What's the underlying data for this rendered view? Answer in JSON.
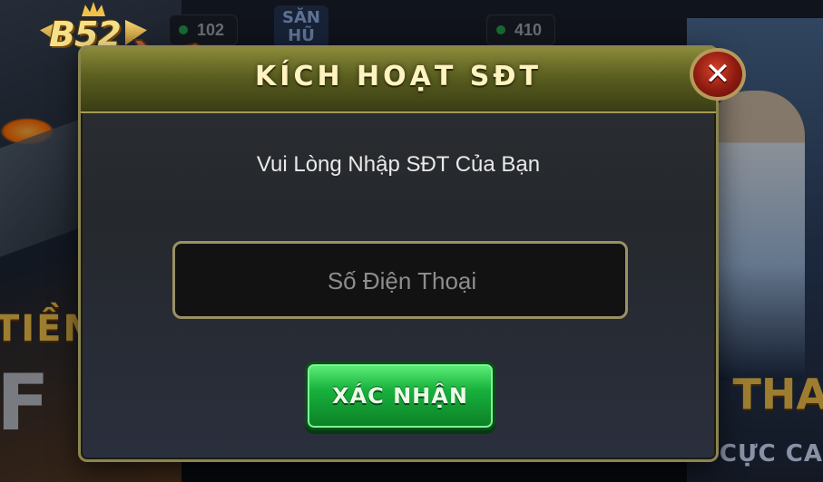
{
  "lobby": {
    "pill_left_value": "102",
    "pill_right_value": "410",
    "card_left_title": "TIỀM",
    "card_left_big": "F",
    "card_right_title": "Ể THA",
    "card_right_sub": "CỰC CA",
    "center_card_tag": "SĂN HŨ"
  },
  "logo": {
    "text": "B52"
  },
  "dialog": {
    "title": "KÍCH HOẠT SĐT",
    "prompt": "Vui Lòng Nhập SĐT Của Bạn",
    "phone_placeholder": "Số Điện Thoại",
    "confirm_label": "XÁC NHẬN",
    "close_glyph": "✕"
  },
  "colors": {
    "dialog_border": "#8a8451",
    "header_gold": "#8a8a3a",
    "confirm_green": "#18b23d",
    "close_red": "#b52a1a"
  }
}
